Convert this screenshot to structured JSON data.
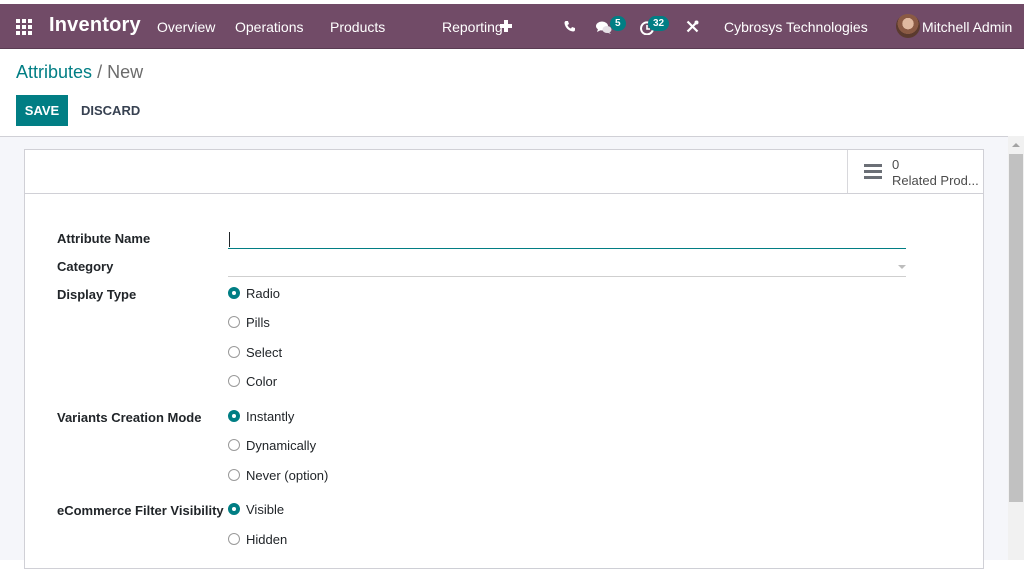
{
  "navbar": {
    "app_name": "Inventory",
    "menu": [
      "Overview",
      "Operations",
      "Products",
      "Reporting"
    ],
    "icons": {
      "apps": "apps-grid-icon",
      "plus": "plus-icon",
      "phone": "phone-icon",
      "messages": "chat-icon",
      "activities": "clock-icon",
      "debug": "tools-icon"
    },
    "messages_count": "5",
    "activities_count": "32",
    "company": "Cybrosys Technologies",
    "user": "Mitchell Admin",
    "color": "#714b67"
  },
  "control_panel": {
    "breadcrumb_parent": "Attributes",
    "breadcrumb_separator": "/",
    "breadcrumb_current": "New",
    "save_label": "SAVE",
    "discard_label": "DISCARD"
  },
  "form": {
    "smart_button": {
      "value": "0",
      "label": "Related Prod..."
    },
    "attribute_name": {
      "label": "Attribute Name",
      "value": ""
    },
    "category": {
      "label": "Category",
      "value": ""
    },
    "display_type": {
      "label": "Display Type",
      "options": [
        "Radio",
        "Pills",
        "Select",
        "Color"
      ],
      "selected": "Radio"
    },
    "variants_creation_mode": {
      "label": "Variants Creation Mode",
      "options": [
        "Instantly",
        "Dynamically",
        "Never (option)"
      ],
      "selected": "Instantly"
    },
    "ecommerce_filter_visibility": {
      "label": "eCommerce Filter Visibility",
      "options": [
        "Visible",
        "Hidden"
      ],
      "selected": "Visible"
    }
  },
  "theme": {
    "accent": "#017e84"
  }
}
